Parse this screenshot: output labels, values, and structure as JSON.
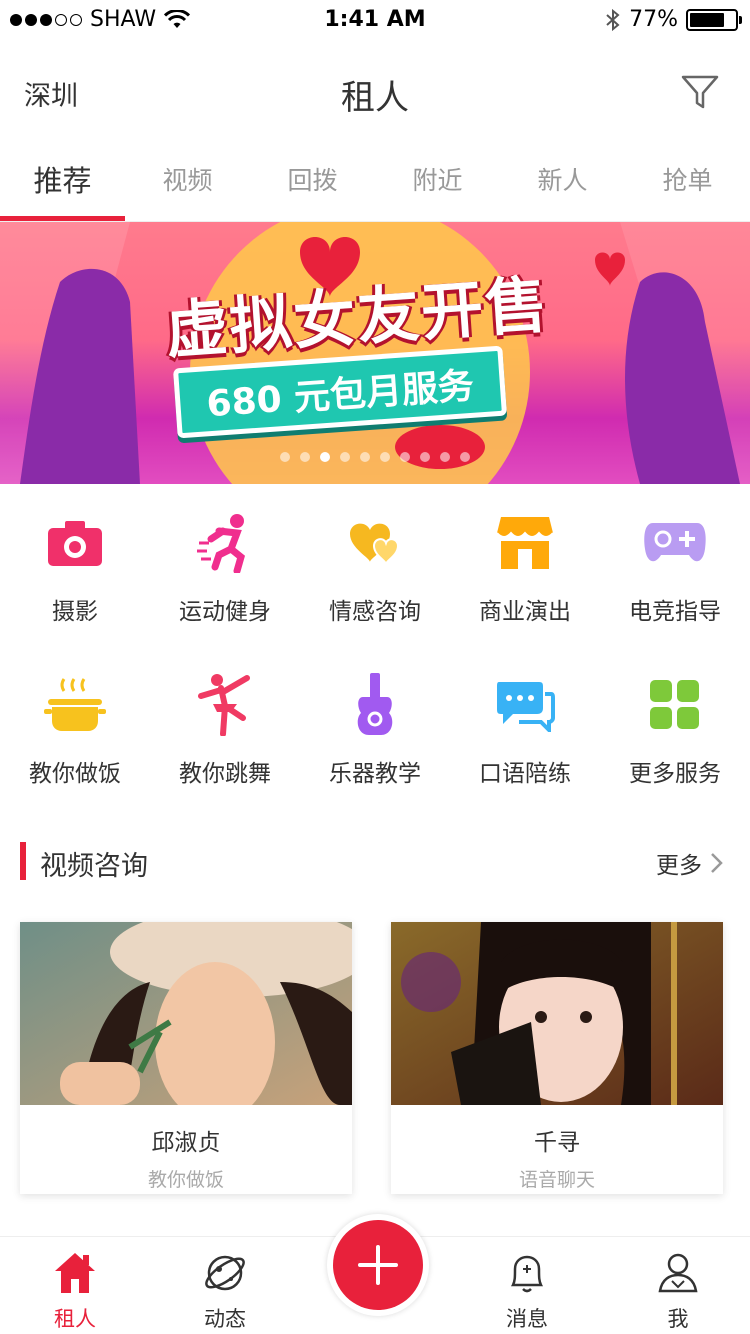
{
  "status_bar": {
    "carrier": "SHAW",
    "time": "1:41 AM",
    "battery": "77%",
    "battery_level": 0.77
  },
  "header": {
    "city": "深圳",
    "title": "租人"
  },
  "tabs": [
    {
      "label": "推荐",
      "active": true
    },
    {
      "label": "视频"
    },
    {
      "label": "回拨"
    },
    {
      "label": "附近"
    },
    {
      "label": "新人"
    },
    {
      "label": "抢单"
    }
  ],
  "banner": {
    "title": "虚拟女友开售",
    "subtitle": "680 元包月服务",
    "page_count": 10,
    "current_page": 3
  },
  "services": [
    {
      "label": "摄影",
      "icon": "camera-icon",
      "color": "#f0306a"
    },
    {
      "label": "运动健身",
      "icon": "running-icon",
      "color": "#f02e8e"
    },
    {
      "label": "情感咨询",
      "icon": "hearts-icon",
      "color": "#f6b820"
    },
    {
      "label": "商业演出",
      "icon": "shop-icon",
      "color": "#ffa90a"
    },
    {
      "label": "电竞指导",
      "icon": "gamepad-icon",
      "color": "#b99cf2"
    },
    {
      "label": "教你做饭",
      "icon": "cooking-pot-icon",
      "color": "#f7c21e"
    },
    {
      "label": "教你跳舞",
      "icon": "dancer-icon",
      "color": "#f03a63"
    },
    {
      "label": "乐器教学",
      "icon": "guitar-icon",
      "color": "#a15af0"
    },
    {
      "label": "口语陪练",
      "icon": "chat-bubbles-icon",
      "color": "#38b2f5"
    },
    {
      "label": "更多服务",
      "icon": "grid-icon",
      "color": "#7ec93a"
    }
  ],
  "video_section": {
    "title": "视频咨询",
    "more_label": "更多",
    "cards": [
      {
        "name": "邱淑贞",
        "subtitle": "教你做饭"
      },
      {
        "name": "千寻",
        "subtitle": "语音聊天"
      }
    ]
  },
  "bottom_nav": [
    {
      "label": "租人",
      "icon": "home-icon",
      "active": true
    },
    {
      "label": "动态",
      "icon": "planet-icon"
    },
    {
      "label": "消息",
      "icon": "bell-icon"
    },
    {
      "label": "我",
      "icon": "user-icon"
    }
  ],
  "colors": {
    "accent": "#e8213b"
  }
}
